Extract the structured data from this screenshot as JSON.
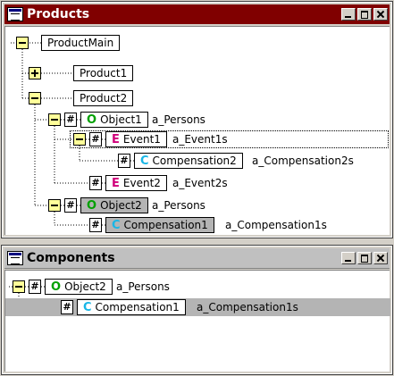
{
  "products_window": {
    "title": "Products",
    "tree": {
      "root": "ProductMain",
      "product1": "Product1",
      "product2": "Product2",
      "object1": {
        "letter": "O",
        "label": "Object1",
        "attr": "a_Persons"
      },
      "event1": {
        "letter": "E",
        "label": "Event1",
        "attr": "a_Event1s"
      },
      "compensation2": {
        "letter": "C",
        "label": "Compensation2",
        "attr": "a_Compensation2s"
      },
      "event2": {
        "letter": "E",
        "label": "Event2",
        "attr": "a_Event2s"
      },
      "object2": {
        "letter": "O",
        "label": "Object2",
        "attr": "a_Persons"
      },
      "compensation1": {
        "letter": "C",
        "label": "Compensation1",
        "attr": "a_Compensation1s"
      }
    }
  },
  "components_window": {
    "title": "Components",
    "tree": {
      "object2": {
        "letter": "O",
        "label": "Object2",
        "attr": "a_Persons"
      },
      "compensation1": {
        "letter": "C",
        "label": "Compensation1",
        "attr": "a_Compensation1s"
      }
    }
  },
  "symbols": {
    "hash": "#",
    "icons": [
      "app-window-icon",
      "minimize-icon",
      "maximize-icon",
      "close-icon",
      "expand-minus-icon",
      "expand-plus-icon",
      "hash-icon"
    ]
  },
  "colors": {
    "active_title": "#800000",
    "object_letter": "#00a000",
    "event_letter": "#d0007a",
    "compensation_letter": "#18b6e6",
    "expander_fill": "#ffff99",
    "selection_grey": "#b4b4b4"
  }
}
